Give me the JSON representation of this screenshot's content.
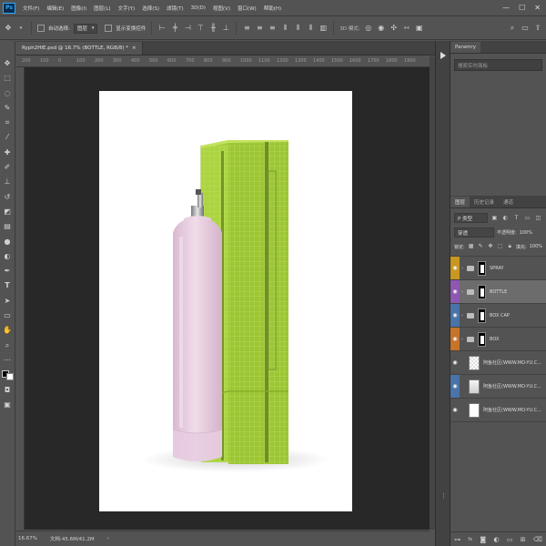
{
  "app": {
    "logo": "Ps"
  },
  "menu": [
    "文件(F)",
    "编辑(E)",
    "图像(I)",
    "图层(L)",
    "文字(Y)",
    "选择(S)",
    "滤镜(T)",
    "3D(D)",
    "视图(V)",
    "窗口(W)",
    "帮助(H)"
  ],
  "window_controls": [
    "—",
    "☐",
    "✕"
  ],
  "options": {
    "auto_select_label": "自动选择:",
    "auto_select_value": "图层",
    "transform_label": "显示变换控件"
  },
  "document_tab": {
    "title": "Ryph2HIE.psd @ 16.7% (BOTTLE, RGB/8) *",
    "close": "×"
  },
  "ruler_ticks": [
    "200",
    "100",
    "0",
    "100",
    "200",
    "300",
    "400",
    "500",
    "600",
    "700",
    "800",
    "900",
    "1000",
    "1100",
    "1200",
    "1300",
    "1400",
    "1500",
    "1600",
    "1700",
    "1800",
    "1900"
  ],
  "status": {
    "zoom": "16.67%",
    "doc": "文档:45.6M/41.2M",
    "arrow": "›"
  },
  "properties_panel": {
    "tab": "Paramry",
    "search_placeholder": "搜索实时面板"
  },
  "layers_panel": {
    "tabs": [
      "图层",
      "历史记录",
      "通道"
    ],
    "filter_label": "P 类型",
    "blend_mode": "穿透",
    "opacity_label": "不透明度:",
    "opacity_value": "100%",
    "lock_label": "锁定:",
    "fill_label": "填充:",
    "fill_value": "100%",
    "layers": [
      {
        "name": "SPRAY",
        "tag_color": "#c9961f",
        "type": "group"
      },
      {
        "name": "BOTTLE",
        "tag_color": "#8d57b3",
        "type": "group",
        "selected": true
      },
      {
        "name": "BOX CAP",
        "tag_color": "#4a73a8",
        "type": "group"
      },
      {
        "name": "BOX",
        "tag_color": "#c6742a",
        "type": "group"
      },
      {
        "name": "阿鱼社区(WWW.MO-YU.C...",
        "tag_color": "#535353",
        "type": "pattern"
      },
      {
        "name": "阿鱼社区(WWW.MO-YU.C...",
        "tag_color": "#4a73a8",
        "type": "image"
      },
      {
        "name": "阿鱼社区(WWW.MO-YU.C...",
        "tag_color": "#535353",
        "type": "white"
      }
    ],
    "footer_icons": [
      "link-icon",
      "fx-icon",
      "mask-icon",
      "adjustment-icon",
      "folder-icon",
      "new-layer-icon",
      "trash-icon"
    ]
  },
  "colors": {
    "box_green": "#a3cd3a",
    "bottle_pink": "#e7cde0",
    "canvas_bg": "#282828"
  }
}
